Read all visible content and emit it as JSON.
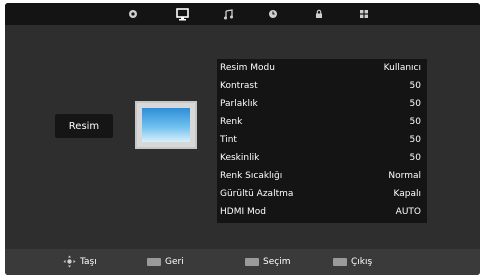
{
  "top_icons": [
    "gear-icon",
    "monitor-icon",
    "music-note-icon",
    "timer-icon",
    "lock-icon",
    "grid-icon"
  ],
  "sidebar": {
    "label": "Resim"
  },
  "menu": {
    "items": [
      {
        "label": "Resim Modu",
        "value": "Kullanıcı"
      },
      {
        "label": "Kontrast",
        "value": "50"
      },
      {
        "label": "Parlaklık",
        "value": "50"
      },
      {
        "label": "Renk",
        "value": "50"
      },
      {
        "label": "Tint",
        "value": "50"
      },
      {
        "label": "Keskinlik",
        "value": "50"
      },
      {
        "label": "Renk Sıcaklığı",
        "value": "Normal"
      },
      {
        "label": "Gürültü Azaltma",
        "value": "Kapalı"
      },
      {
        "label": "HDMI Mod",
        "value": "AUTO"
      }
    ]
  },
  "footer": {
    "tasi": "Taşı",
    "geri": "Geri",
    "secim": "Seçim",
    "cikis": "Çıkış"
  }
}
